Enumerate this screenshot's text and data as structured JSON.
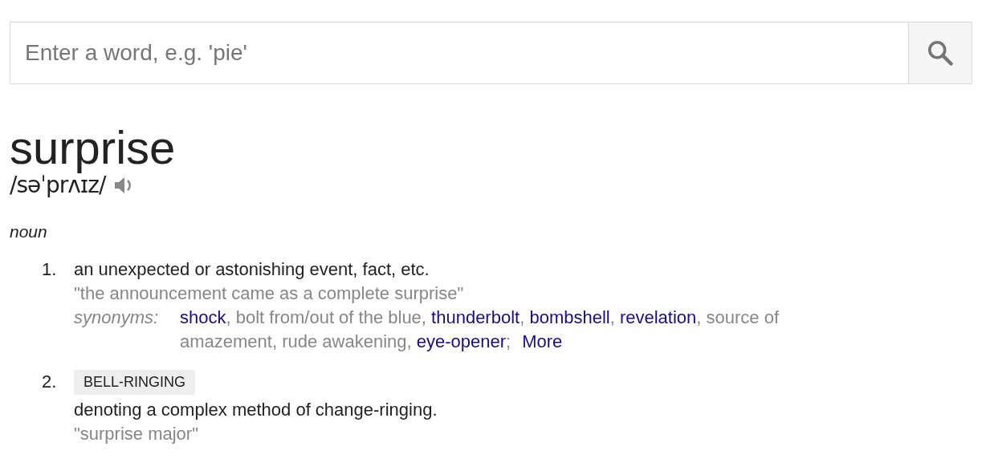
{
  "search": {
    "placeholder": "Enter a word, e.g. 'pie'"
  },
  "entry": {
    "word": "surprise",
    "pronunciation": "/səˈprʌɪz/",
    "part_of_speech": "noun",
    "senses": [
      {
        "number": "1.",
        "definition": "an unexpected or astonishing event, fact, etc.",
        "example": "\"the announcement came as a complete surprise\"",
        "synonyms_label": "synonyms:",
        "synonyms": [
          {
            "kind": "link",
            "text": "shock"
          },
          {
            "kind": "plain",
            "text": ", bolt from/out of the blue, "
          },
          {
            "kind": "link",
            "text": "thunderbolt"
          },
          {
            "kind": "plain",
            "text": ", "
          },
          {
            "kind": "link",
            "text": "bombshell"
          },
          {
            "kind": "plain",
            "text": ", "
          },
          {
            "kind": "link",
            "text": "revelation"
          },
          {
            "kind": "plain",
            "text": ", source of "
          },
          {
            "kind": "plain",
            "text": "amazement, rude awakening, "
          },
          {
            "kind": "link",
            "text": "eye-opener"
          },
          {
            "kind": "plain",
            "text": ";"
          }
        ],
        "more": "More"
      },
      {
        "number": "2.",
        "label": "BELL-RINGING",
        "definition": "denoting a complex method of change-ringing.",
        "example": "\"surprise major\""
      }
    ]
  }
}
